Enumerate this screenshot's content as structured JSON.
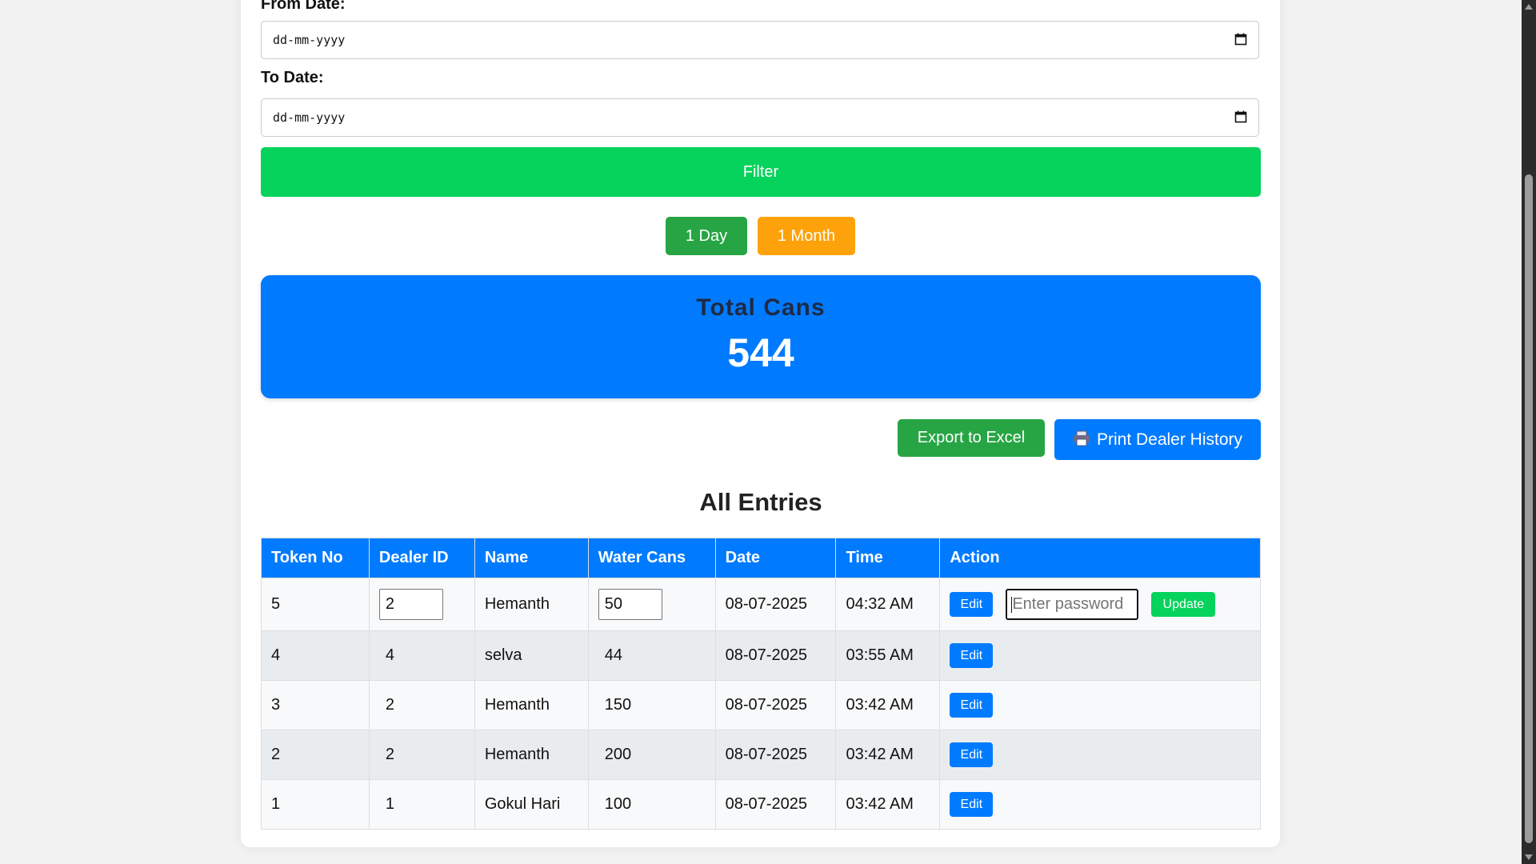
{
  "filters": {
    "from_label": "From Date:",
    "to_label": "To Date:",
    "date_placeholder": "dd-mm-yyyy",
    "filter_button": "Filter",
    "quick_day": "1 Day",
    "quick_month": "1 Month"
  },
  "summary": {
    "label": "Total Cans",
    "value": "544"
  },
  "actions": {
    "export_button": "Export to Excel",
    "print_button": "Print Dealer History"
  },
  "entries": {
    "title": "All Entries",
    "headers": [
      "Token No",
      "Dealer ID",
      "Name",
      "Water Cans",
      "Date",
      "Time",
      "Action"
    ],
    "edit_label": "Edit",
    "update_label": "Update",
    "password_placeholder": "Enter password",
    "rows": [
      {
        "token": "5",
        "dealer_id": "2",
        "name": "Hemanth",
        "cans": "50",
        "date": "08-07-2025",
        "time": "04:32 AM"
      },
      {
        "token": "4",
        "dealer_id": "4",
        "name": "selva",
        "cans": "44",
        "date": "08-07-2025",
        "time": "03:55 AM"
      },
      {
        "token": "3",
        "dealer_id": "2",
        "name": "Hemanth",
        "cans": "150",
        "date": "08-07-2025",
        "time": "03:42 AM"
      },
      {
        "token": "2",
        "dealer_id": "2",
        "name": "Hemanth",
        "cans": "200",
        "date": "08-07-2025",
        "time": "03:42 AM"
      },
      {
        "token": "1",
        "dealer_id": "1",
        "name": "Gokul Hari",
        "cans": "100",
        "date": "08-07-2025",
        "time": "03:42 AM"
      }
    ]
  },
  "colors": {
    "primary": "#007bff",
    "success": "#27a544",
    "filter_green": "#06d35b",
    "warning": "#fda20b"
  }
}
